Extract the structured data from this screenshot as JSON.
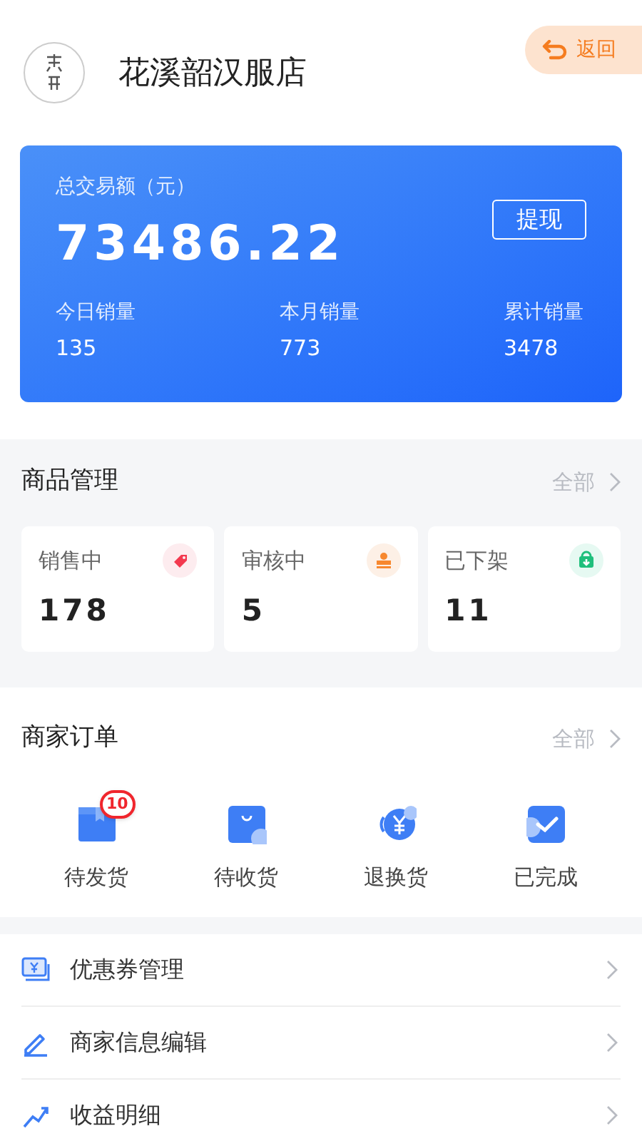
{
  "header": {
    "store_name": "花溪韶汉服店",
    "back_button": "返回"
  },
  "summary": {
    "label": "总交易额（元）",
    "amount": "73486.22",
    "withdraw_button": "提现",
    "stats": [
      {
        "label": "今日销量",
        "value": "135"
      },
      {
        "label": "本月销量",
        "value": "773"
      },
      {
        "label": "累计销量",
        "value": "3478"
      }
    ]
  },
  "products": {
    "title": "商品管理",
    "more": "全部",
    "cards": [
      {
        "label": "销售中",
        "value": "178"
      },
      {
        "label": "审核中",
        "value": "5"
      },
      {
        "label": "已下架",
        "value": "11"
      }
    ]
  },
  "orders": {
    "title": "商家订单",
    "more": "全部",
    "items": [
      {
        "label": "待发货",
        "badge": "10"
      },
      {
        "label": "待收货"
      },
      {
        "label": "退换货"
      },
      {
        "label": "已完成"
      }
    ]
  },
  "menu": [
    {
      "label": "优惠券管理"
    },
    {
      "label": "商家信息编辑"
    },
    {
      "label": "收益明细"
    }
  ]
}
